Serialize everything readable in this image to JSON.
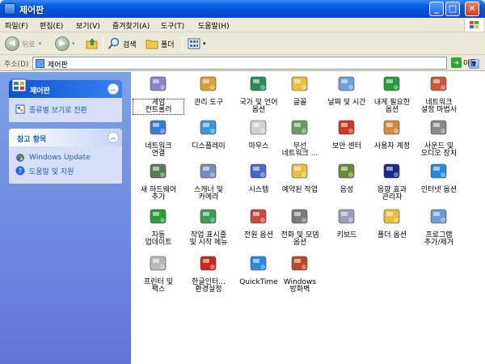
{
  "window": {
    "title": "제어판",
    "minimize_label": "_",
    "maximize_label": "□",
    "close_label": "✕"
  },
  "menu": [
    "파일(F)",
    "편집(E)",
    "보기(V)",
    "즐겨찾기(A)",
    "도구(T)",
    "도움말(H)"
  ],
  "toolbar": {
    "back_label": "뒤로",
    "search_label": "검색",
    "folders_label": "폴더"
  },
  "address": {
    "label": "주소(D)",
    "value": "제어판",
    "go_label": "이동"
  },
  "left_panes": {
    "control_panel": {
      "title": "제어판",
      "task": "종류별 보기로 전환"
    },
    "see_also": {
      "title": "참고 항목",
      "links": [
        "Windows Update",
        "도움말 및 지원"
      ]
    }
  },
  "items": [
    {
      "label": "게임\n컨트롤러",
      "icon": "gamepad-icon",
      "color": "#8a86c8"
    },
    {
      "label": "관리 도구",
      "icon": "admin-tools-icon",
      "color": "#d8a03a"
    },
    {
      "label": "국가 및 언어\n옵션",
      "icon": "globe-icon",
      "color": "#2a8a5a"
    },
    {
      "label": "글꼴",
      "icon": "fonts-folder-icon",
      "color": "#e8c040"
    },
    {
      "label": "날짜 및 시간",
      "icon": "clock-icon",
      "color": "#6aa0e0"
    },
    {
      "label": "내게 필요한\n옵션",
      "icon": "accessibility-icon",
      "color": "#2a9a3a"
    },
    {
      "label": "네트워크\n설정 마법사",
      "icon": "network-wizard-icon",
      "color": "#c85a3a"
    },
    {
      "label": "네트워크\n연결",
      "icon": "network-connections-icon",
      "color": "#3a7ad8"
    },
    {
      "label": "디스플레이",
      "icon": "display-icon",
      "color": "#3a9ad8"
    },
    {
      "label": "마우스",
      "icon": "mouse-icon",
      "color": "#cfcfcf"
    },
    {
      "label": "무선\n네트워크 ...",
      "icon": "wireless-icon",
      "color": "#6a9a6a"
    },
    {
      "label": "보안 센터",
      "icon": "shield-icon",
      "color": "#c83a2a"
    },
    {
      "label": "사용자 계정",
      "icon": "users-icon",
      "color": "#d88a3a"
    },
    {
      "label": "사운드 및\n오디오 장치",
      "icon": "speaker-icon",
      "color": "#8a8a8a"
    },
    {
      "label": "새 하드웨어\n추가",
      "icon": "hardware-icon",
      "color": "#5a7a5a"
    },
    {
      "label": "스캐너 및\n카메라",
      "icon": "scanner-icon",
      "color": "#7a8ab8"
    },
    {
      "label": "시스템",
      "icon": "system-icon",
      "color": "#4a6ac8"
    },
    {
      "label": "예약된 작업",
      "icon": "scheduled-tasks-icon",
      "color": "#e8c040"
    },
    {
      "label": "음성",
      "icon": "speech-icon",
      "color": "#6a8a3a"
    },
    {
      "label": "음향 효과\n관리자",
      "icon": "sound-effects-icon",
      "color": "#1a2a8a"
    },
    {
      "label": "인터넷 옵션",
      "icon": "internet-options-icon",
      "color": "#2a8ad8"
    },
    {
      "label": "자동\n업데이트",
      "icon": "windows-update-icon",
      "color": "#2a9a3a"
    },
    {
      "label": "작업 표시줄\n및 시작 메뉴",
      "icon": "taskbar-icon",
      "color": "#3a9a5a"
    },
    {
      "label": "전원 옵션",
      "icon": "power-icon",
      "color": "#c84a3a"
    },
    {
      "label": "전화 및 모뎀\n옵션",
      "icon": "phone-modem-icon",
      "color": "#7a7a7a"
    },
    {
      "label": "키보드",
      "icon": "keyboard-icon",
      "color": "#9aa0b8"
    },
    {
      "label": "폴더 옵션",
      "icon": "folder-options-icon",
      "color": "#e8c040"
    },
    {
      "label": "프로그램\n추가/제거",
      "icon": "add-remove-programs-icon",
      "color": "#6a9ad8"
    },
    {
      "label": "프린터 및\n팩스",
      "icon": "printer-icon",
      "color": "#b8b8b8"
    },
    {
      "label": "한글인터...\n환경설정",
      "icon": "hangul-ime-icon",
      "color": "#c82a1a"
    },
    {
      "label": "QuickTime",
      "icon": "quicktime-icon",
      "color": "#2a8ae8"
    },
    {
      "label": "Windows\n방화벽",
      "icon": "firewall-icon",
      "color": "#b84a2a"
    }
  ]
}
